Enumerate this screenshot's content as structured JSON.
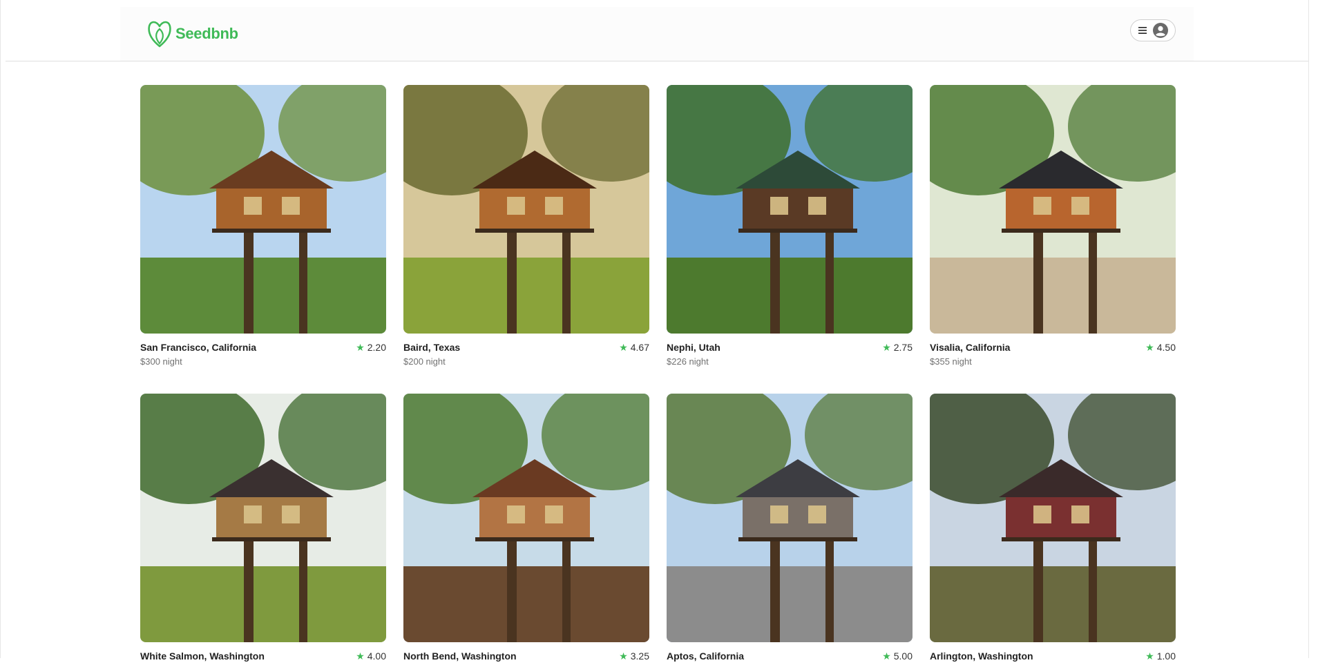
{
  "app": {
    "name": "Seedbnb",
    "accent": "#3fba57"
  },
  "header": {
    "menu_icon": "menu-icon",
    "avatar_icon": "user-avatar-icon"
  },
  "listings": [
    {
      "location": "San Francisco, California",
      "rating": "2.20",
      "price": "$300 night",
      "sky": "#b9d5ef",
      "ground": "#5d8b3a",
      "foliage": "#6d8f3c",
      "wood": "#a8642c",
      "roof": "#6a3c20"
    },
    {
      "location": "Baird, Texas",
      "rating": "4.67",
      "price": "$200 night",
      "sky": "#d6c79a",
      "ground": "#8aa33a",
      "foliage": "#6a6a30",
      "wood": "#b06a30",
      "roof": "#4b2a15"
    },
    {
      "location": "Nephi, Utah",
      "rating": "2.75",
      "price": "$226 night",
      "sky": "#6fa6d8",
      "ground": "#4d7a2e",
      "foliage": "#3f6f2a",
      "wood": "#5a3a25",
      "roof": "#2d4a38"
    },
    {
      "location": "Visalia, California",
      "rating": "4.50",
      "price": "$355 night",
      "sky": "#dfe7d2",
      "ground": "#c9b89a",
      "foliage": "#4f7a35",
      "wood": "#b8652e",
      "roof": "#2a2a2e"
    },
    {
      "location": "White Salmon, Washington",
      "rating": "4.00",
      "price": "",
      "sky": "#e7ece6",
      "ground": "#7f9a3e",
      "foliage": "#3e6a2c",
      "wood": "#a57a45",
      "roof": "#3a3030"
    },
    {
      "location": "North Bend, Washington",
      "rating": "3.25",
      "price": "",
      "sky": "#c7dbe8",
      "ground": "#6a4a30",
      "foliage": "#4f7a30",
      "wood": "#b27444",
      "roof": "#6a3a22"
    },
    {
      "location": "Aptos, California",
      "rating": "5.00",
      "price": "",
      "sky": "#b8d2ea",
      "ground": "#8c8c8c",
      "foliage": "#5a7a3a",
      "wood": "#7a7068",
      "roof": "#3d3d42"
    },
    {
      "location": "Arlington, Washington",
      "rating": "1.00",
      "price": "",
      "sky": "#c9d5e2",
      "ground": "#6a6a40",
      "foliage": "#3a4a2a",
      "wood": "#7a3030",
      "roof": "#3a2a2a"
    }
  ]
}
